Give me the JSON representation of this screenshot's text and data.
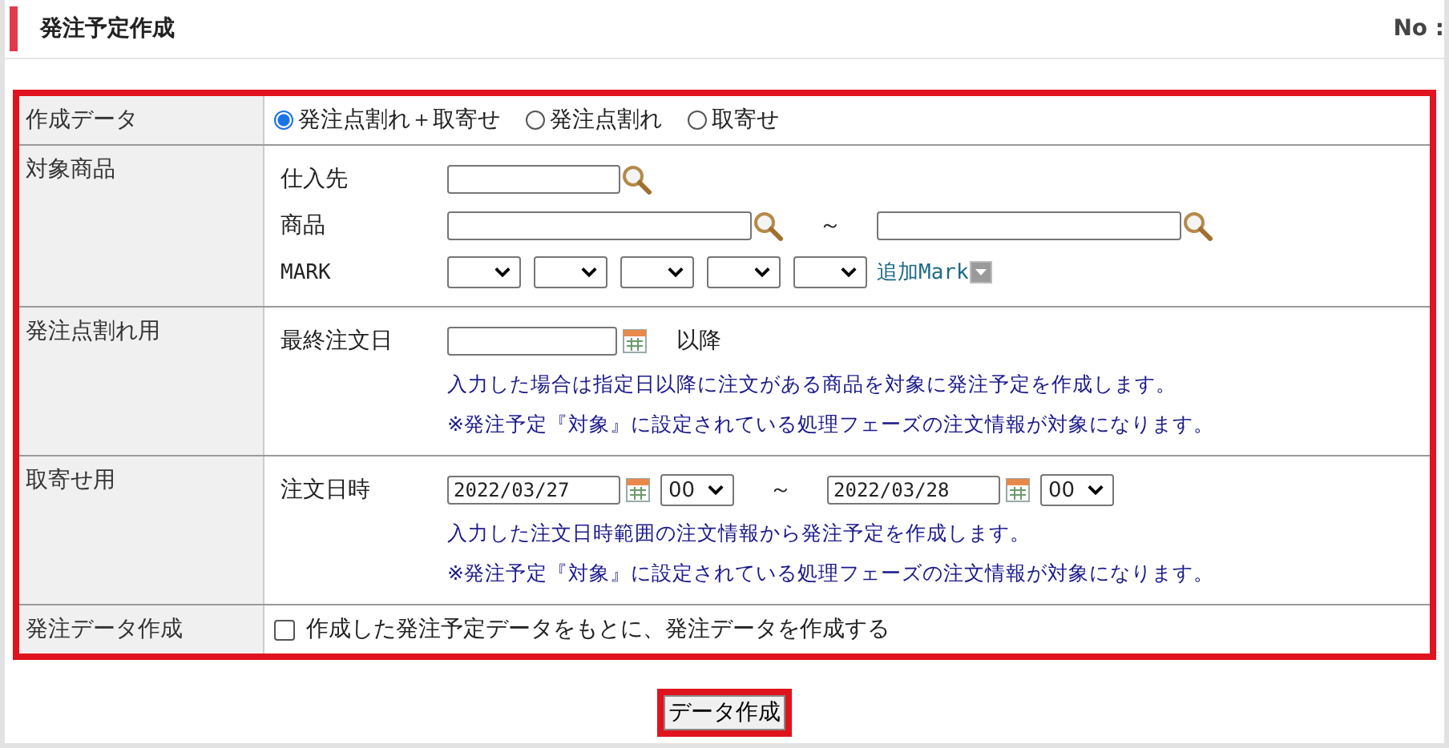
{
  "header": {
    "title": "発注予定作成",
    "number_label": "No :"
  },
  "form": {
    "create_data": {
      "label": "作成データ",
      "options": [
        {
          "label": "発注点割れ＋取寄せ",
          "selected": true
        },
        {
          "label": "発注点割れ",
          "selected": false
        },
        {
          "label": "取寄せ",
          "selected": false
        }
      ]
    },
    "target_products": {
      "label": "対象商品",
      "supplier": {
        "label": "仕入先"
      },
      "product": {
        "label": "商品",
        "separator": "～"
      },
      "mark": {
        "label": "MARK",
        "selects": [
          {
            "kind": "select"
          },
          {
            "kind": "select"
          },
          {
            "kind": "select"
          },
          {
            "kind": "select"
          },
          {
            "kind": "select"
          }
        ],
        "add_link": "追加Mark"
      }
    },
    "below_reorder": {
      "label": "発注点割れ用",
      "field_label": "最終注文日",
      "suffix": "以降",
      "notes": [
        "入力した場合は指定日以降に注文がある商品を対象に発注予定を作成します。",
        "※発注予定『対象』に設定されている処理フェーズの注文情報が対象になります。"
      ]
    },
    "backorder": {
      "label": "取寄せ用",
      "field_label": "注文日時",
      "from": {
        "date": "2022/03/27",
        "hour": "00"
      },
      "separator": "～",
      "to": {
        "date": "2022/03/28",
        "hour": "00"
      },
      "notes": [
        "入力した注文日時範囲の注文情報から発注予定を作成します。",
        "※発注予定『対象』に設定されている処理フェーズの注文情報が対象になります。"
      ]
    },
    "order_data": {
      "label": "発注データ作成",
      "checkbox": {
        "label": "作成した発注予定データをもとに、発注データを作成する",
        "checked": false
      }
    }
  },
  "submit_button": "データ作成"
}
